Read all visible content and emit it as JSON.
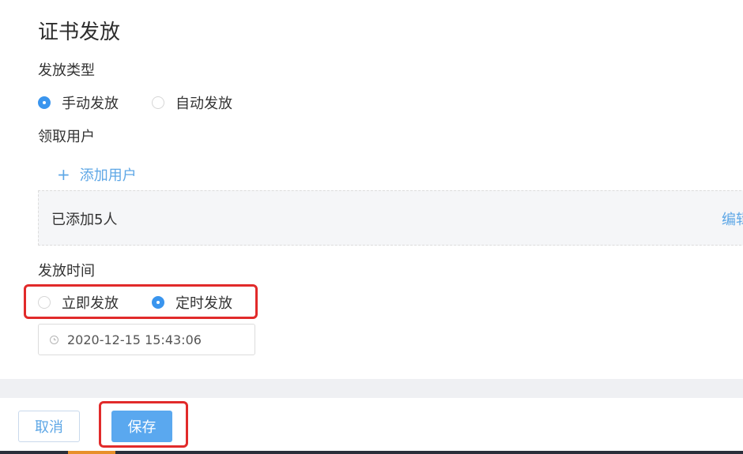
{
  "form": {
    "title": "证书发放",
    "issue_type": {
      "label": "发放类型",
      "options": [
        {
          "label": "手动发放",
          "checked": true
        },
        {
          "label": "自动发放",
          "checked": false
        }
      ]
    },
    "recipients": {
      "label": "领取用户",
      "add_user_label": "添加用户",
      "add_user_symbol": "+",
      "added_summary": "已添加5人",
      "edit_label": "编辑"
    },
    "issue_time": {
      "label": "发放时间",
      "options": [
        {
          "label": "立即发放",
          "checked": false
        },
        {
          "label": "定时发放",
          "checked": true
        }
      ],
      "datetime_value": "2020-12-15 15:43:06"
    }
  },
  "footer": {
    "cancel_label": "取消",
    "save_label": "保存"
  },
  "colors": {
    "accent": "#3a95ee",
    "link": "#5ea7e6",
    "highlight": "#e12a2a"
  }
}
